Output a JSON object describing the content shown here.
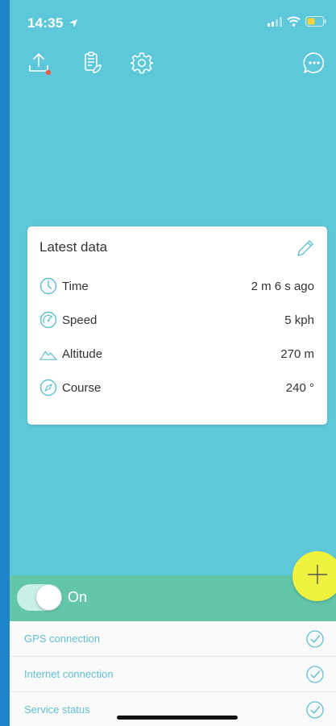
{
  "status_bar": {
    "time": "14:35",
    "location_icon": "location-arrow-icon",
    "signal_icon": "cellular-signal-icon",
    "wifi_icon": "wifi-icon",
    "battery_icon": "battery-low-icon"
  },
  "toolbar": {
    "upload_icon": "upload-icon",
    "log_icon": "log-document-icon",
    "settings_icon": "gear-icon",
    "chat_icon": "chat-bubble-icon",
    "upload_badge_color": "#e8594a"
  },
  "card": {
    "title": "Latest data",
    "edit_icon": "pencil-icon",
    "rows": [
      {
        "icon": "clock-icon",
        "label": "Time",
        "value": "2 m 6 s ago"
      },
      {
        "icon": "speedometer-icon",
        "label": "Speed",
        "value": "5 kph"
      },
      {
        "icon": "mountain-icon",
        "label": "Altitude",
        "value": "270 m"
      },
      {
        "icon": "compass-icon",
        "label": "Course",
        "value": "240 °"
      }
    ]
  },
  "fab": {
    "icon": "plus-icon",
    "color": "#f0f240"
  },
  "tracking": {
    "label": "On",
    "enabled": true
  },
  "status_items": [
    {
      "label": "GPS connection",
      "icon": "check-circle-icon"
    },
    {
      "label": "Internet connection",
      "icon": "check-circle-icon"
    },
    {
      "label": "Service status",
      "icon": "check-circle-icon"
    }
  ],
  "colors": {
    "background": "#5ec8db",
    "accent": "#5fbfcf",
    "toggle_bar": "#63c6a8",
    "battery": "#f5d33a"
  }
}
